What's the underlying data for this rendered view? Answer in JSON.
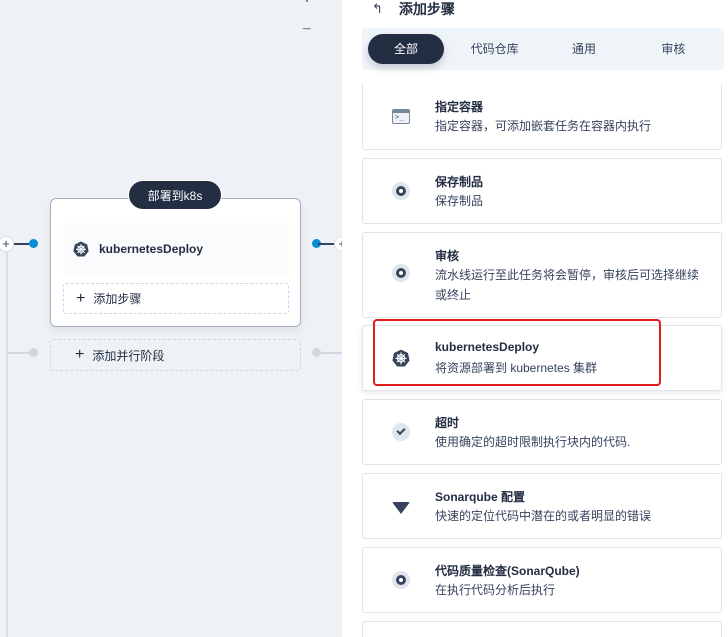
{
  "panel": {
    "title": "添加步骤",
    "tabs": [
      {
        "label": "全部",
        "active": true
      },
      {
        "label": "代码仓库",
        "active": false
      },
      {
        "label": "通用",
        "active": false
      },
      {
        "label": "审核",
        "active": false
      }
    ],
    "items": [
      {
        "icon": "terminal-icon",
        "name": "指定容器",
        "desc": "指定容器，可添加嵌套任务在容器内执行"
      },
      {
        "icon": "ring-icon",
        "name": "保存制品",
        "desc": "保存制品"
      },
      {
        "icon": "ring-icon",
        "name": "审核",
        "desc": "流水线运行至此任务将会暂停，审核后可选择继续或终止"
      },
      {
        "icon": "kubernetes-icon",
        "name": "kubernetesDeploy",
        "desc": "将资源部署到 kubernetes 集群"
      },
      {
        "icon": "clock-icon",
        "name": "超时",
        "desc": "使用确定的超时限制执行块内的代码."
      },
      {
        "icon": "sonarqube-icon",
        "name": "Sonarqube 配置",
        "desc": "快速的定位代码中潜在的或者明显的错误"
      },
      {
        "icon": "ring-icon",
        "name": "代码质量检查(SonarQube)",
        "desc": "在执行代码分析后执行"
      }
    ]
  },
  "canvas": {
    "stage_title": "部署到k8s",
    "step_name": "kubernetesDeploy",
    "add_step": "添加步骤",
    "add_parallel": "添加并行阶段",
    "plus_symbol": "+",
    "minus_symbol": "−"
  },
  "icons": {
    "back": "↰",
    "terminal_prompt": ">_"
  },
  "colors": {
    "accent": "#242e42",
    "connector_blue": "#0a8ad6",
    "highlight_red": "#e21b1b"
  }
}
